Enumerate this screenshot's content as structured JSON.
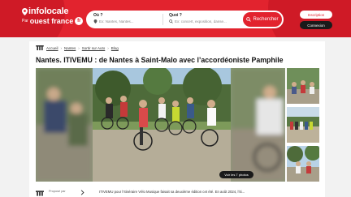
{
  "header": {
    "logo": {
      "brand": "infolocale",
      "par": "Par",
      "owner": "ouest france",
      "badge": "fr"
    },
    "search": {
      "where_label": "Où ?",
      "where_placeholder": "Ex: Nantes, Nantes...",
      "what_label": "Quoi ?",
      "what_placeholder": "Ex: concert, exposition, danse...",
      "button_label": "Rechercher"
    },
    "signup_label": "Inscription",
    "login_label": "Connexion"
  },
  "breadcrumb": {
    "items": [
      "Accueil",
      "Nantes",
      "Sortir sur Auto",
      "Blog"
    ]
  },
  "article": {
    "title": "Nantes. ITIVEMU : de Nantes à Saint-Malo avec l’accordéoniste Pamphile",
    "gallery_button": "Voir les 7 photos",
    "proposed_by": "Proposé par",
    "intro": "ITIVEMU pour l’Itinéraire Vélo Musique faisait sa deuxième édition cet été. En août 2024, l’iti..."
  },
  "colors": {
    "brand_red": "#e2232e",
    "dark": "#1a1a1a"
  }
}
